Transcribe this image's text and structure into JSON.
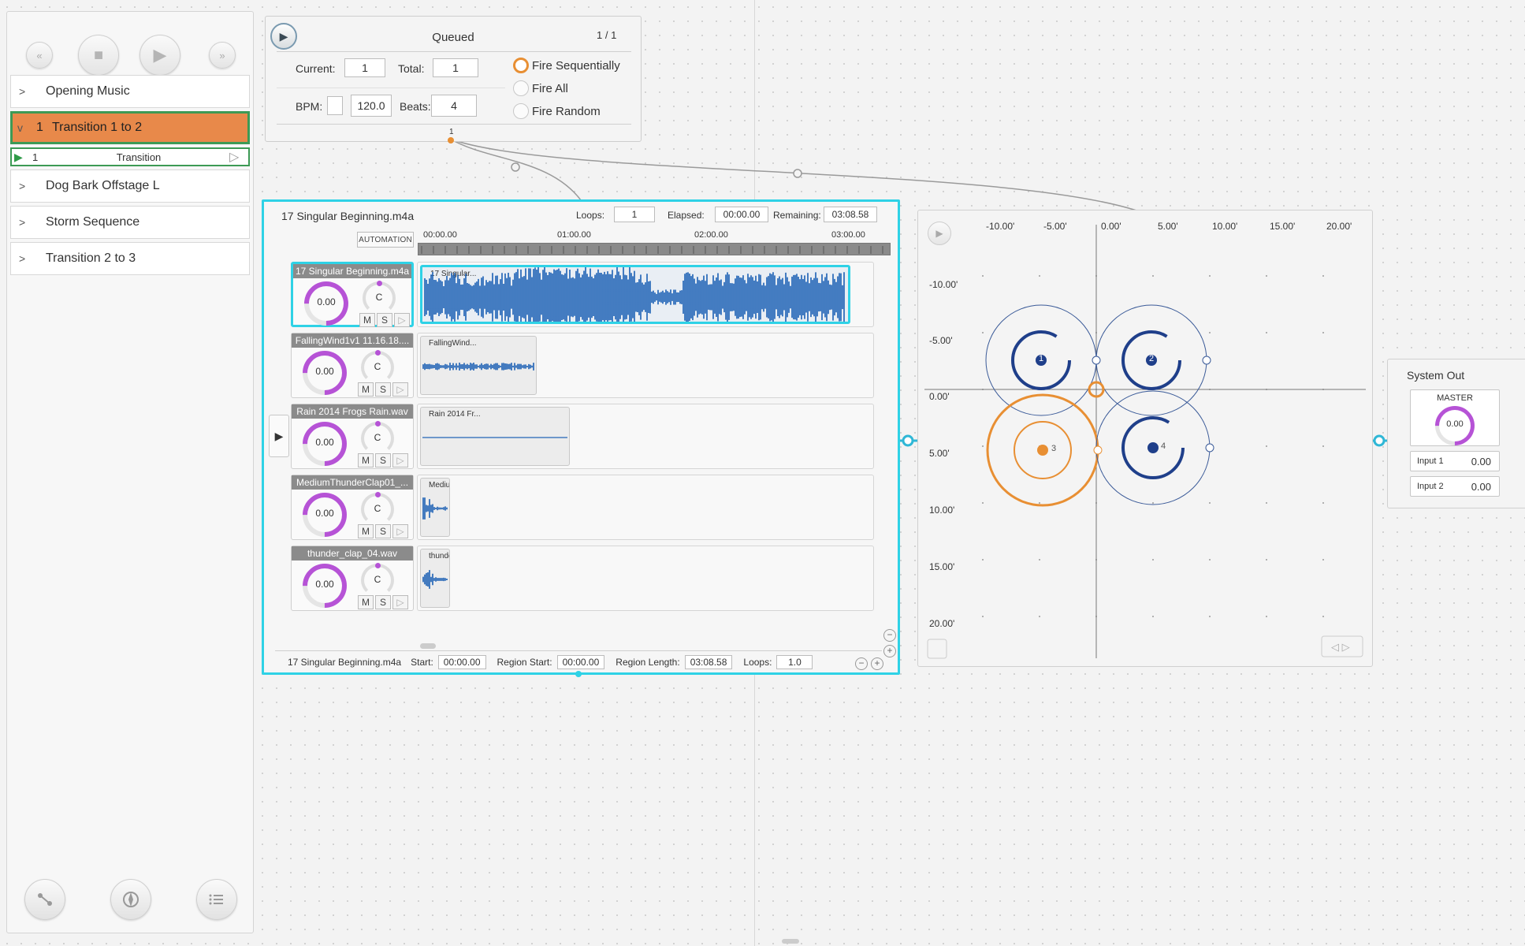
{
  "transport": {
    "rewind": "«",
    "stop": "■",
    "play": "▶",
    "forward": "»"
  },
  "cues": [
    {
      "label": "Opening Music",
      "chevron": ">"
    },
    {
      "label": "Transition 1 to 2",
      "number": "1",
      "chevron": "v",
      "active": true
    },
    {
      "label": "Dog Bark Offstage L",
      "chevron": ">"
    },
    {
      "label": "Storm Sequence",
      "chevron": ">"
    },
    {
      "label": "Transition 2 to 3",
      "chevron": ">"
    }
  ],
  "child_cue": {
    "number": "1",
    "label": "Transition"
  },
  "queue": {
    "title": "Queued",
    "count": "1 / 1",
    "current_label": "Current:",
    "current_value": "1",
    "total_label": "Total:",
    "total_value": "1",
    "bpm_label": "BPM:",
    "bpm_value": "120.0",
    "beats_label": "Beats:",
    "beats_value": "4",
    "fire_options": [
      "Fire Sequentially",
      "Fire All",
      "Fire Random"
    ],
    "selected_option": "Fire Sequentially",
    "port_label": "1"
  },
  "editor": {
    "title": "17 Singular Beginning.m4a",
    "loops_label": "Loops:",
    "loops_value": "1",
    "elapsed_label": "Elapsed:",
    "elapsed_value": "00:00.00",
    "remaining_label": "Remaining:",
    "remaining_value": "03:08.58",
    "automation_label": "AUTOMATION",
    "timeline": [
      "00:00.00",
      "01:00.00",
      "02:00.00",
      "03:00.00"
    ],
    "tracks": [
      {
        "name": "17 Singular Beginning.m4a",
        "clip": "17 Singular...",
        "volume": "0.00",
        "pan": "C",
        "selected": true
      },
      {
        "name": "FallingWind1v1 11.16.18....",
        "clip": "FallingWind...",
        "volume": "0.00",
        "pan": "C"
      },
      {
        "name": "Rain 2014 Frogs Rain.wav",
        "clip": "Rain 2014 Fr...",
        "volume": "0.00",
        "pan": "C"
      },
      {
        "name": "MediumThunderClap01_...",
        "clip": "MediumThu...",
        "volume": "0.00",
        "pan": "C"
      },
      {
        "name": "thunder_clap_04.wav",
        "clip": "thunder_cla...",
        "volume": "0.00",
        "pan": "C"
      }
    ],
    "mute": "M",
    "solo": "S",
    "footer": {
      "file": "17 Singular Beginning.m4a",
      "start_label": "Start:",
      "start_value": "00:00.00",
      "region_start_label": "Region Start:",
      "region_start_value": "00:00.00",
      "region_length_label": "Region Length:",
      "region_length_value": "03:08.58",
      "loops_label": "Loops:",
      "loops_value": "1.0"
    }
  },
  "spatial": {
    "x_labels": [
      "-10.00'",
      "-5.00'",
      "0.00'",
      "5.00'",
      "10.00'",
      "15.00'",
      "20.00'"
    ],
    "y_labels": [
      "-10.00'",
      "-5.00'",
      "0.00'",
      "5.00'",
      "10.00'",
      "15.00'",
      "20.00'"
    ],
    "speakers": [
      {
        "label": "1",
        "color": "#1f3f8a"
      },
      {
        "label": "2",
        "color": "#1f3f8a"
      },
      {
        "label": "3",
        "color": "#e88f33"
      },
      {
        "label": "4",
        "color": "#1f3f8a"
      }
    ]
  },
  "system_out": {
    "title": "System Out",
    "master_label": "MASTER",
    "master_value": "0.00",
    "inputs": [
      {
        "label": "Input 1",
        "value": "0.00"
      },
      {
        "label": "Input 2",
        "value": "0.00"
      }
    ]
  },
  "colors": {
    "accent_cyan": "#2fd2e6",
    "cue_active": "#e88f33",
    "cue_border": "#3d9a55",
    "knob_purple": "#b653d6",
    "wave_blue": "#1a5fb4"
  }
}
